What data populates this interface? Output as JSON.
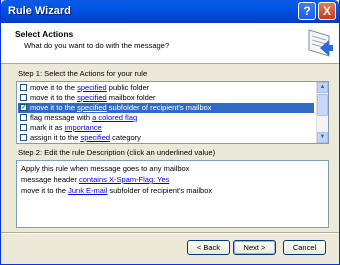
{
  "window": {
    "title": "Rule Wizard",
    "help_button": "?",
    "close_button": "X"
  },
  "header": {
    "title": "Select Actions",
    "subtitle": "What do you want to do with the message?",
    "icon": "rule-wizard-icon"
  },
  "step1": {
    "label": "Step 1: Select the Actions for your rule",
    "actions": [
      {
        "checked": false,
        "selected": false,
        "pre": "move it to the ",
        "link": "specified",
        "post": " public folder"
      },
      {
        "checked": false,
        "selected": false,
        "pre": "move it to the ",
        "link": "specified",
        "post": " mailbox folder"
      },
      {
        "checked": true,
        "selected": true,
        "pre": "move it to the ",
        "link": "specified",
        "post": " subfolder of recipient's mailbox"
      },
      {
        "checked": false,
        "selected": false,
        "pre": "flag message with ",
        "link": "a colored flag",
        "post": ""
      },
      {
        "checked": false,
        "selected": false,
        "pre": "mark it as ",
        "link": "importance",
        "post": ""
      },
      {
        "checked": false,
        "selected": false,
        "pre": "assign it to the ",
        "link": "specified",
        "post": " category"
      }
    ]
  },
  "step2": {
    "label": "Step 2: Edit the rule Description (click an underlined value)",
    "lines": [
      {
        "pre": "Apply this rule when message goes to any mailbox",
        "link": "",
        "post": ""
      },
      {
        "pre": "message header ",
        "link": "contains X-Spam-Flag: Yes",
        "post": ""
      },
      {
        "pre": "move it to the ",
        "link": "Junk E-mail",
        "post": " subfolder of recipient's mailbox"
      }
    ]
  },
  "buttons": {
    "back": "< Back",
    "next": "Next >",
    "cancel": "Cancel"
  },
  "colors": {
    "titlebar": "#0054e3",
    "selection": "#316ac5",
    "link": "#0000ee"
  }
}
